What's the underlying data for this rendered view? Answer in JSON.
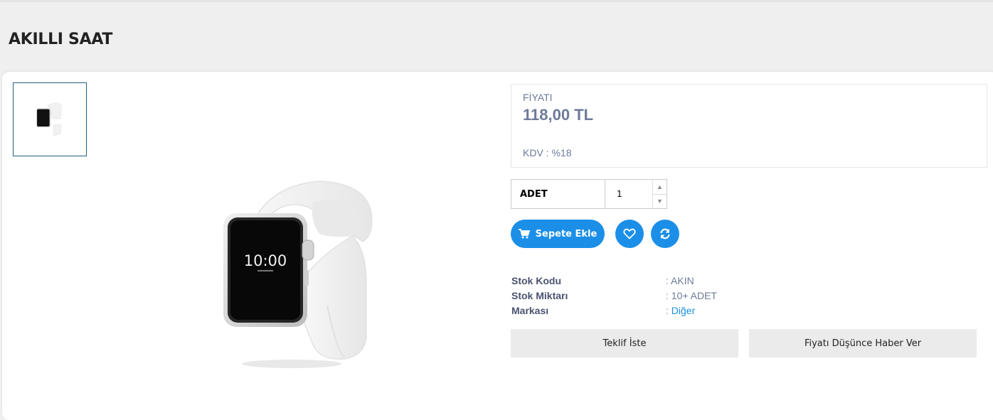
{
  "page": {
    "title": "AKILLI SAAT"
  },
  "gallery": {
    "thumb_icon": "smartwatch-thumbnail",
    "main_icon": "smartwatch-image",
    "watch_time": "10:00"
  },
  "price": {
    "label": "FİYATI",
    "value": "118,00 TL",
    "tax_label": "KDV :",
    "tax_value": "%18"
  },
  "quantity": {
    "label": "ADET",
    "value": "1",
    "up_icon": "chevron-up-icon",
    "down_icon": "chevron-down-icon"
  },
  "actions": {
    "cart_label": "Sepete Ekle",
    "cart_icon": "cart-icon",
    "favorite_icon": "heart-icon",
    "compare_icon": "refresh-icon",
    "accent_color": "#1b8fe8"
  },
  "details": [
    {
      "key": "Stok Kodu",
      "sep": ":",
      "value": "AKIN"
    },
    {
      "key": "Stok Miktarı",
      "sep": ":",
      "value": "10+ ADET"
    },
    {
      "key": "Markası",
      "sep": ":",
      "value": "Diğer"
    }
  ],
  "buttons": {
    "offer_label": "Teklif İste",
    "notify_label": "Fiyatı Düşünce Haber Ver"
  }
}
